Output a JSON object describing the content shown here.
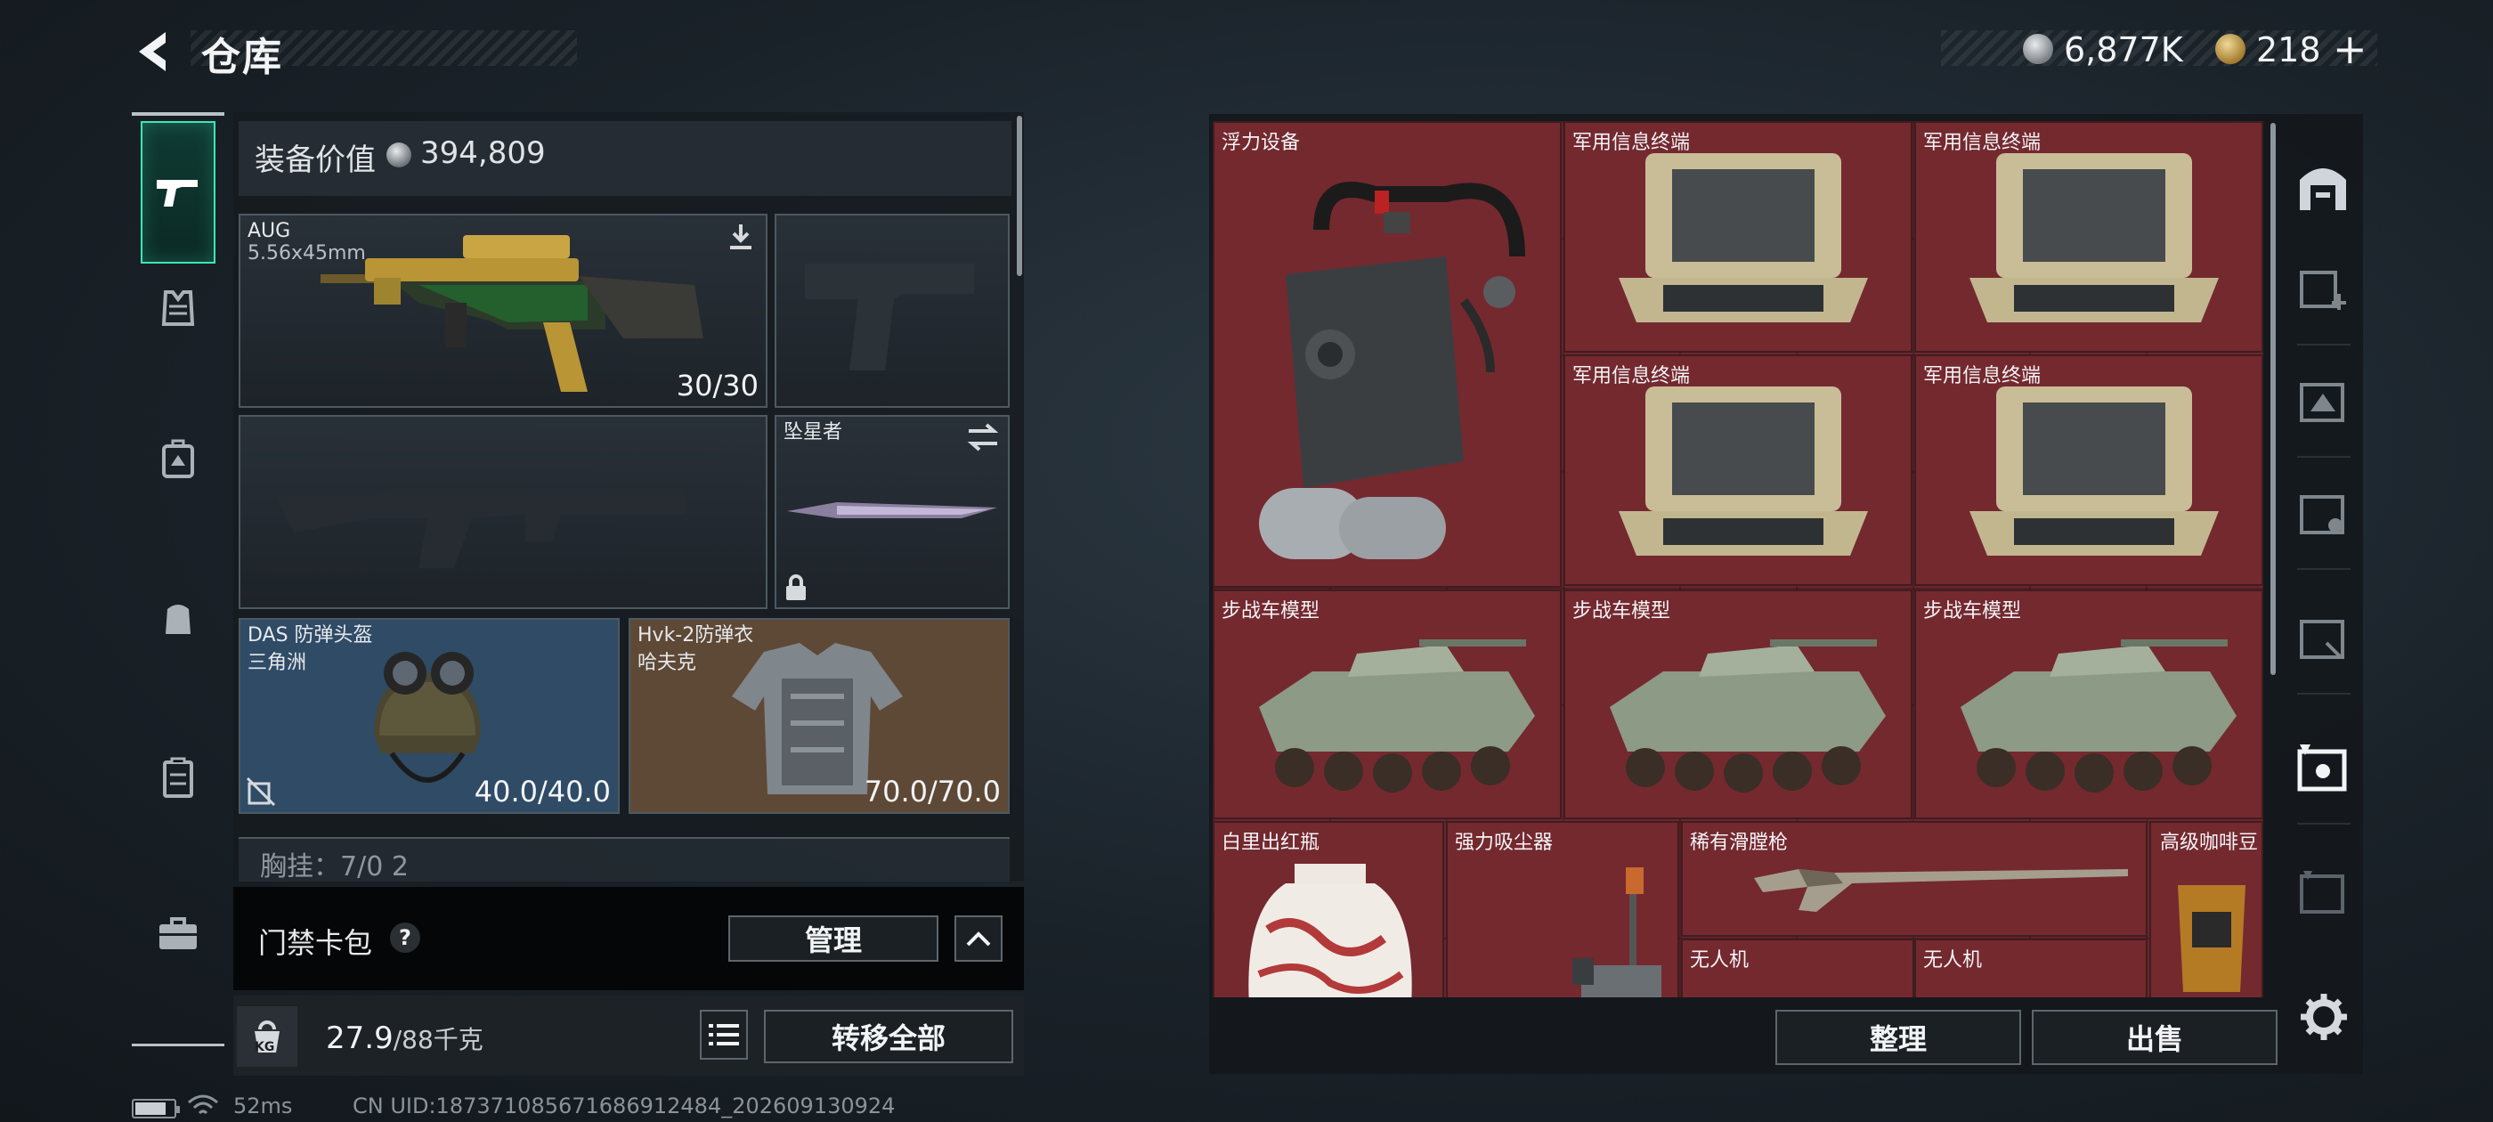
{
  "header": {
    "title": "仓库",
    "currency_silver": "6,877K",
    "currency_gold": "218",
    "plus_label": "+"
  },
  "equipment": {
    "value_label": "装备价值",
    "value_amount": "394,809",
    "primary_weapon": {
      "name": "AUG",
      "caliber": "5.56x45mm",
      "ammo": "30/30"
    },
    "melee": {
      "name": "坠星者"
    },
    "helmet": {
      "name": "DAS 防弹头盔",
      "brand": "三角洲",
      "durability": "40.0/40.0"
    },
    "armor": {
      "name": "Hvk-2防弹衣",
      "brand": "哈夫克",
      "durability": "70.0/70.0"
    },
    "vest_peek": "胸挂：7/0   2"
  },
  "keycard": {
    "label": "门禁卡包",
    "help": "?",
    "manage_label": "管理"
  },
  "weight": {
    "current": "27.9",
    "max": "/88千克",
    "transfer_label": "转移全部",
    "icon_text": "KG"
  },
  "status": {
    "ping": "52ms",
    "uid": "CN UID:187371085671686912484_202609130924"
  },
  "stash": {
    "items": [
      {
        "label": "浮力设备"
      },
      {
        "label": "军用信息终端"
      },
      {
        "label": "军用信息终端"
      },
      {
        "label": "军用信息终端"
      },
      {
        "label": "军用信息终端"
      },
      {
        "label": "步战车模型"
      },
      {
        "label": "步战车模型"
      },
      {
        "label": "步战车模型"
      },
      {
        "label": "白里出红瓶"
      },
      {
        "label": "强力吸尘器"
      },
      {
        "label": "稀有滑膛枪"
      },
      {
        "label": "高级咖啡豆"
      },
      {
        "label": "无人机"
      },
      {
        "label": "无人机"
      }
    ],
    "sort_label": "整理",
    "sell_label": "出售"
  },
  "colors": {
    "accent": "#3ee6b5",
    "stash_cell": "#74292f",
    "helmet_bg": "#2f4b66",
    "armor_bg": "#5e4936"
  }
}
